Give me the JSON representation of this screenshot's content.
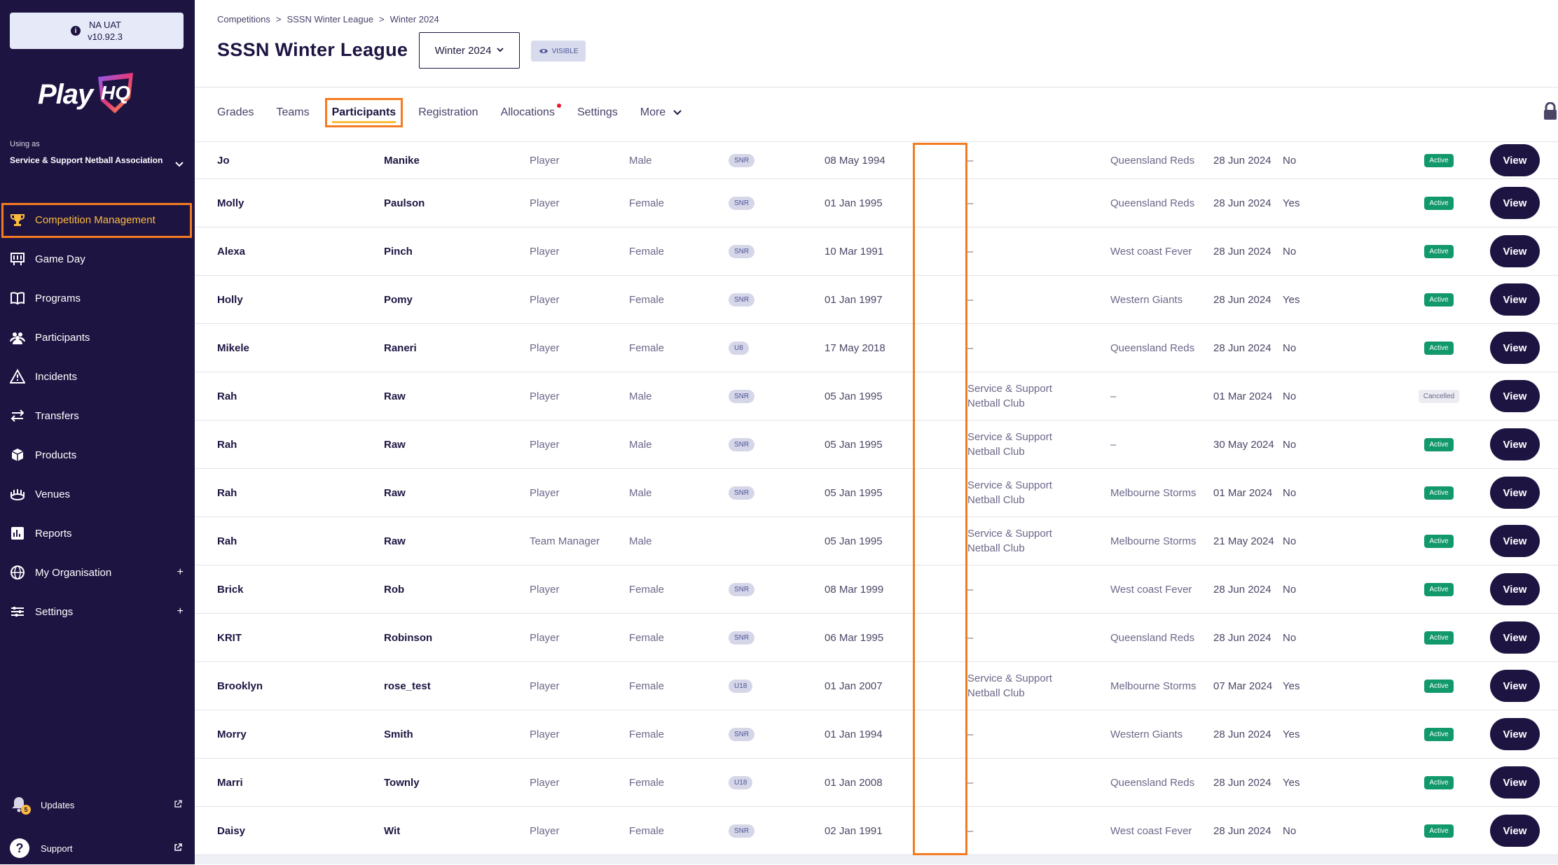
{
  "env": {
    "name": "NA UAT",
    "version": "v10.92.3"
  },
  "logo": {
    "play": "Play",
    "hq": "HQ"
  },
  "org": {
    "using_as": "Using as",
    "name": "Service & Support Netball Association"
  },
  "nav": [
    {
      "label": "Competition Management",
      "icon": "trophy-icon"
    },
    {
      "label": "Game Day",
      "icon": "scoreboard-icon"
    },
    {
      "label": "Programs",
      "icon": "book-icon"
    },
    {
      "label": "Participants",
      "icon": "people-icon"
    },
    {
      "label": "Incidents",
      "icon": "warning-icon"
    },
    {
      "label": "Transfers",
      "icon": "transfer-arrows-icon"
    },
    {
      "label": "Products",
      "icon": "boxes-icon"
    },
    {
      "label": "Venues",
      "icon": "stadium-icon"
    },
    {
      "label": "Reports",
      "icon": "report-icon"
    },
    {
      "label": "My Organisation",
      "icon": "globe-icon",
      "expand": "+"
    },
    {
      "label": "Settings",
      "icon": "sliders-icon",
      "expand": "+"
    }
  ],
  "bottom_links": {
    "updates": "Updates",
    "updates_badge": "5",
    "support": "Support"
  },
  "breadcrumb": [
    "Competitions",
    "SSSN Winter League",
    "Winter 2024"
  ],
  "page_title": "SSSN Winter League",
  "season_select": "Winter 2024",
  "visibility_badge": "VISIBLE",
  "tabs": [
    "Grades",
    "Teams",
    "Participants",
    "Registration",
    "Allocations",
    "Settings",
    "More"
  ],
  "active_tab": "Participants",
  "view_label": "View",
  "rows": [
    {
      "first": "Jo",
      "last": "Manike",
      "role": "Player",
      "gender": "Male",
      "age": "SNR",
      "dob": "08 May 1994",
      "club": "–",
      "team": "Queensland Reds",
      "date": "28 Jun 2024",
      "fin": "No",
      "status": "Active"
    },
    {
      "first": "Molly",
      "last": "Paulson",
      "role": "Player",
      "gender": "Female",
      "age": "SNR",
      "dob": "01 Jan 1995",
      "club": "–",
      "team": "Queensland Reds",
      "date": "28 Jun 2024",
      "fin": "Yes",
      "status": "Active"
    },
    {
      "first": "Alexa",
      "last": "Pinch",
      "role": "Player",
      "gender": "Female",
      "age": "SNR",
      "dob": "10 Mar 1991",
      "club": "–",
      "team": "West coast Fever",
      "date": "28 Jun 2024",
      "fin": "No",
      "status": "Active"
    },
    {
      "first": "Holly",
      "last": "Pomy",
      "role": "Player",
      "gender": "Female",
      "age": "SNR",
      "dob": "01 Jan 1997",
      "club": "–",
      "team": "Western Giants",
      "date": "28 Jun 2024",
      "fin": "Yes",
      "status": "Active"
    },
    {
      "first": "Mikele",
      "last": "Raneri",
      "role": "Player",
      "gender": "Female",
      "age": "U8",
      "dob": "17 May 2018",
      "club": "–",
      "team": "Queensland Reds",
      "date": "28 Jun 2024",
      "fin": "No",
      "status": "Active"
    },
    {
      "first": "Rah",
      "last": "Raw",
      "role": "Player",
      "gender": "Male",
      "age": "SNR",
      "dob": "05 Jan 1995",
      "club": "Service & Support Netball Club",
      "team": "–",
      "date": "01 Mar 2024",
      "fin": "No",
      "status": "Cancelled"
    },
    {
      "first": "Rah",
      "last": "Raw",
      "role": "Player",
      "gender": "Male",
      "age": "SNR",
      "dob": "05 Jan 1995",
      "club": "Service & Support Netball Club",
      "team": "–",
      "date": "30 May 2024",
      "fin": "No",
      "status": "Active"
    },
    {
      "first": "Rah",
      "last": "Raw",
      "role": "Player",
      "gender": "Male",
      "age": "SNR",
      "dob": "05 Jan 1995",
      "club": "Service & Support Netball Club",
      "team": "Melbourne Storms",
      "date": "01 Mar 2024",
      "fin": "No",
      "status": "Active"
    },
    {
      "first": "Rah",
      "last": "Raw",
      "role": "Team Manager",
      "gender": "Male",
      "age": "",
      "dob": "05 Jan 1995",
      "club": "Service & Support Netball Club",
      "team": "Melbourne Storms",
      "date": "21 May 2024",
      "fin": "No",
      "status": "Active"
    },
    {
      "first": "Brick",
      "last": "Rob",
      "role": "Player",
      "gender": "Female",
      "age": "SNR",
      "dob": "08 Mar 1999",
      "club": "–",
      "team": "West coast Fever",
      "date": "28 Jun 2024",
      "fin": "No",
      "status": "Active"
    },
    {
      "first": "KRIT",
      "last": "Robinson",
      "role": "Player",
      "gender": "Female",
      "age": "SNR",
      "dob": "06 Mar 1995",
      "club": "–",
      "team": "Queensland Reds",
      "date": "28 Jun 2024",
      "fin": "No",
      "status": "Active"
    },
    {
      "first": "Brooklyn",
      "last": "rose_test",
      "role": "Player",
      "gender": "Female",
      "age": "U18",
      "dob": "01 Jan 2007",
      "club": "Service & Support Netball Club",
      "team": "Melbourne Storms",
      "date": "07 Mar 2024",
      "fin": "Yes",
      "status": "Active"
    },
    {
      "first": "Morry",
      "last": "Smith",
      "role": "Player",
      "gender": "Female",
      "age": "SNR",
      "dob": "01 Jan 1994",
      "club": "–",
      "team": "Western Giants",
      "date": "28 Jun 2024",
      "fin": "Yes",
      "status": "Active"
    },
    {
      "first": "Marri",
      "last": "Townly",
      "role": "Player",
      "gender": "Female",
      "age": "U18",
      "dob": "01 Jan 2008",
      "club": "–",
      "team": "Queensland Reds",
      "date": "28 Jun 2024",
      "fin": "Yes",
      "status": "Active"
    },
    {
      "first": "Daisy",
      "last": "Wit",
      "role": "Player",
      "gender": "Female",
      "age": "SNR",
      "dob": "02 Jan 1991",
      "club": "–",
      "team": "West coast Fever",
      "date": "28 Jun 2024",
      "fin": "No",
      "status": "Active"
    }
  ],
  "colors": {
    "sidebar": "#1e1442",
    "highlight": "#f47b21",
    "active_nav": "#fdbb3b",
    "status_active": "#12996b"
  }
}
